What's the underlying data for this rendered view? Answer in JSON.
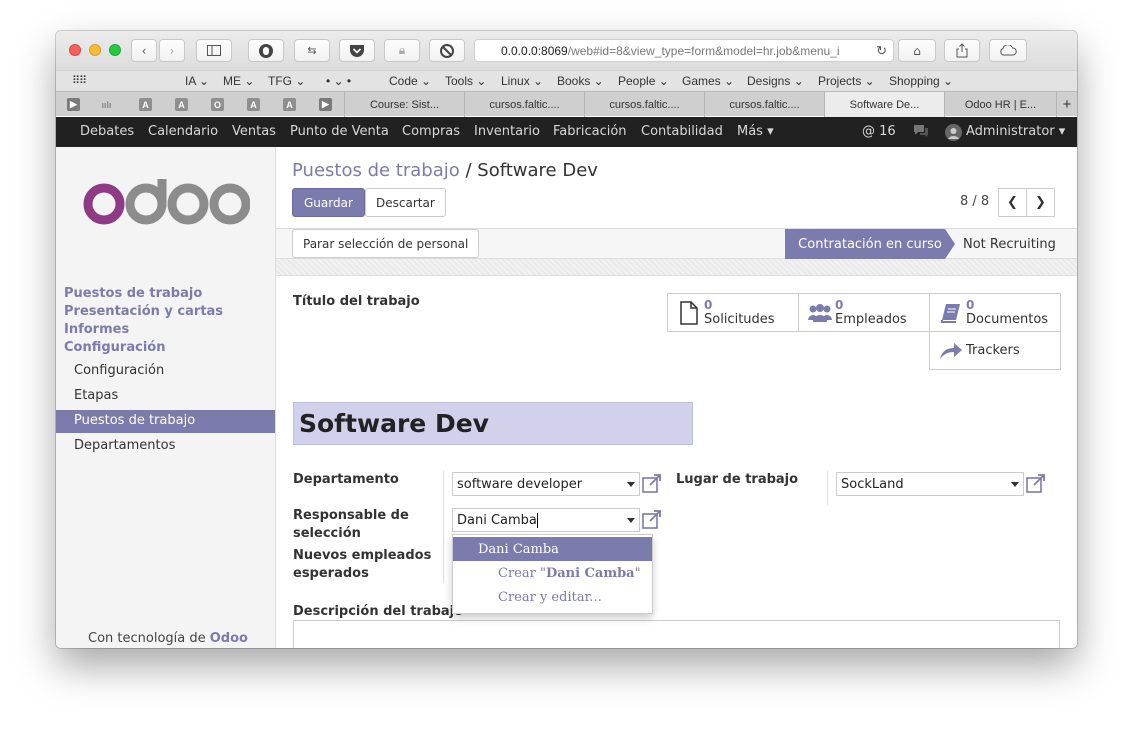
{
  "browser": {
    "url_host": "0.0.0.0:8069",
    "url_path": "/web#id=8&view_type=form&model=hr.job&menu_i",
    "bookmarks": [
      "IA ⌄",
      "ME ⌄",
      "TFG ⌄",
      "•  ⌄  •",
      "Code ⌄",
      "Tools ⌄",
      "Linux ⌄",
      "Books ⌄",
      "People ⌄",
      "Games ⌄",
      "Designs ⌄",
      "Projects ⌄",
      "Shopping ⌄"
    ],
    "pinned_tabs": [
      "A",
      "A",
      "O",
      "A",
      "A"
    ],
    "tabs": [
      "Course: Sist...",
      "cursos.faltic....",
      "cursos.faltic....",
      "cursos.faltic....",
      "Software De...",
      "Odoo HR | E..."
    ],
    "new_tab_label": "+"
  },
  "topnav": {
    "items": [
      "Debates",
      "Calendario",
      "Ventas",
      "Punto de Venta",
      "Compras",
      "Inventario",
      "Fabricación",
      "Contabilidad",
      "Más ▾"
    ],
    "mention_count": "@ 16",
    "user": "Administrator ▾"
  },
  "sidebar": {
    "logo_text": "odoo",
    "headers": [
      "Puestos de trabajo",
      "Presentación y cartas",
      "Informes",
      "Configuración"
    ],
    "items": [
      "Configuración",
      "Etapas",
      "Puestos de trabajo",
      "Departamentos"
    ],
    "powered_prefix": "Con tecnología de ",
    "powered_brand": "Odoo"
  },
  "control_panel": {
    "breadcrumb_parent": "Puestos de trabajo",
    "breadcrumb_sep": " / ",
    "breadcrumb_current": "Software Dev",
    "save_label": "Guardar",
    "discard_label": "Descartar",
    "pager": "8 / 8"
  },
  "statusbar": {
    "select_staff_button": "Parar selección de personal",
    "stage_active": "Contratación en curso",
    "stage_other": "Not Recruiting"
  },
  "form": {
    "job_title_label": "Título del trabajo",
    "job_title_value": "Software Dev",
    "smart_buttons": {
      "applications": {
        "count": "0",
        "label": "Solicitudes"
      },
      "employees": {
        "count": "0",
        "label": "Empleados"
      },
      "documents": {
        "count": "0",
        "label": "Documentos"
      },
      "trackers": {
        "label": "Trackers"
      }
    },
    "department_label": "Departamento",
    "department_value": "software developer",
    "workplace_label": "Lugar de trabajo",
    "workplace_value": "SockLand",
    "responsible_label_1": "Responsable de",
    "responsible_label_2": "selección",
    "responsible_value": "Dani Camba",
    "expected_label_1": "Nuevos empleados",
    "expected_label_2": "esperados",
    "description_label": "Descripción del trabajo"
  },
  "autocomplete": {
    "match": "Dani Camba",
    "create_prefix": "Crear \"",
    "create_name": "Dani Camba",
    "create_suffix": "\"",
    "create_edit": "Crear y editar..."
  },
  "colors": {
    "accent": "#7c7bad",
    "navbar": "#212121",
    "title_field_bg": "#d2d1ec"
  }
}
